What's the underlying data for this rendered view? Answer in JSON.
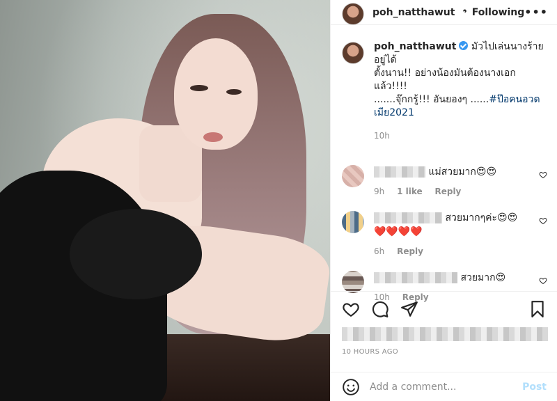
{
  "post": {
    "username": "poh_natthawut",
    "follow_state": "Following",
    "more_label": "•••",
    "caption_lines": [
      "มัวไปเล่นนางร้ายอยู่ได้",
      "ตั้งนาน!! อย่างน้องมันต้องนางเอกแล้ว!!!!",
      ".......จุ๊กกรู้!!! อันยองๆ ......"
    ],
    "hashtag_part1": "#ป๊อคนอวด",
    "hashtag_part2": "เมีย2021",
    "caption_time": "10h",
    "timestamp": "10 HOURS AGO"
  },
  "comments": [
    {
      "text": "แม่สวยมาก😍😍",
      "time": "9h",
      "likes": "1 like",
      "reply": "Reply"
    },
    {
      "text": "สวยมากๆค่ะ😍😍",
      "text2": "❤️❤️❤️❤️",
      "time": "6h",
      "reply": "Reply"
    },
    {
      "text": "สวยมาก😍",
      "time": "10h",
      "reply": "Reply"
    }
  ],
  "add_comment": {
    "placeholder": "Add a comment...",
    "post_label": "Post"
  },
  "icons": [
    "heart-icon",
    "comment-icon",
    "share-icon",
    "bookmark-icon",
    "emoji-icon",
    "more-icon",
    "verified-icon"
  ],
  "colors": {
    "link": "#00376b",
    "verified": "#3897f0",
    "muted": "#8e8e8e",
    "post_disabled": "#b2dffc"
  }
}
